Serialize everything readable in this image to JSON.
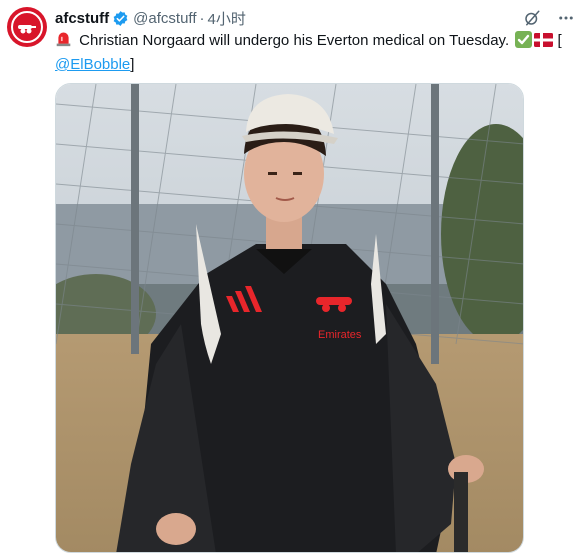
{
  "tweet": {
    "author_name": "afcstuff",
    "handle": "@afcstuff",
    "separator": "·",
    "time": "4小时",
    "text_main": " Christian Norgaard will undergo his Everton medical on Tuesday. ",
    "text_bracket_open": " [",
    "mention": "@ElBobble",
    "text_bracket_close": "]",
    "photo": {
      "shirt_sponsor": "Emirates"
    }
  },
  "icons": {
    "avatar": "arsenal-cannon-badge",
    "verified": "verified-badge-icon",
    "grok": "grok-icon",
    "more": "more-icon",
    "siren": "police-light-emoji",
    "check": "check-mark-emoji",
    "flag": "denmark-flag-emoji"
  },
  "colors": {
    "link": "#1d9bf0",
    "verified": "#1d9bf0",
    "avatar_bg": "#d8152a",
    "secondary_text": "#536471"
  }
}
